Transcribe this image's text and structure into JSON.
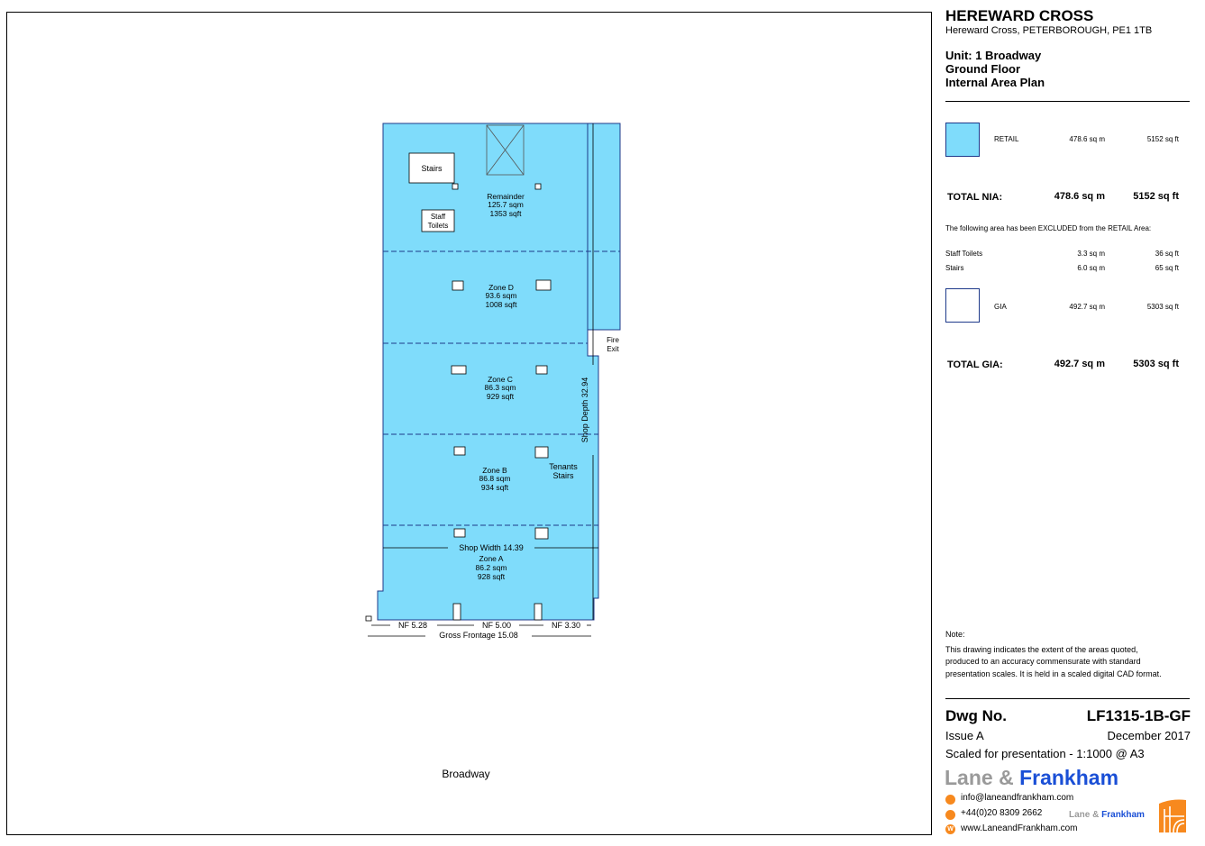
{
  "title": "HEREWARD CROSS",
  "address": "Hereward Cross, PETERBOROUGH, PE1 1TB",
  "unit_lines": [
    "Unit: 1 Broadway",
    "Ground Floor",
    "Internal Area Plan"
  ],
  "legend": {
    "retail": {
      "label": "RETAIL",
      "sqm": "478.6 sq m",
      "sqft": "5152 sq ft",
      "color": "#7fdcfb"
    },
    "total_nia": {
      "label": "TOTAL NIA:",
      "sqm": "478.6 sq m",
      "sqft": "5152 sq ft"
    },
    "excluded_note": "The following area has been EXCLUDED from the RETAIL Area:",
    "excluded": [
      {
        "label": "Staff Toilets",
        "sqm": "3.3 sq m",
        "sqft": "36 sq ft"
      },
      {
        "label": "Stairs",
        "sqm": "6.0 sq m",
        "sqft": "65 sq ft"
      }
    ],
    "gia": {
      "label": "GIA",
      "sqm": "492.7 sq m",
      "sqft": "5303 sq ft"
    },
    "total_gia": {
      "label": "TOTAL GIA:",
      "sqm": "492.7 sq m",
      "sqft": "5303 sq ft"
    }
  },
  "note": {
    "heading": "Note:",
    "lines": [
      "This drawing indicates the extent of the areas quoted,",
      "produced to an accuracy commensurate with standard",
      "presentation scales. It is held in a scaled digital CAD format."
    ]
  },
  "drawing": {
    "dwg_label": "Dwg No.",
    "dwg_no": "LF1315-1B-GF",
    "issue": "Issue  A",
    "date": "December 2017",
    "scale": "Scaled for presentation - 1:1000 @ A3"
  },
  "brand": {
    "name_part1": "Lane",
    "ampersand": "&",
    "name_part2": "Frankham",
    "email": "info@laneandfrankham.com",
    "phone": "+44(0)20 8309 2662",
    "web": "www.LaneandFrankham.com",
    "web_icon": "W",
    "small_part1": "Lane",
    "small_amp": "&",
    "small_part2": "Frankham",
    "accent_orange": "#f7891e",
    "accent_blue": "#1a4fd6"
  },
  "plan": {
    "stairs": "Stairs",
    "staff_toilets": [
      "Staff",
      "Toilets"
    ],
    "fire_exit": [
      "Fire",
      "Exit"
    ],
    "tenants_stairs": [
      "Tenants",
      "Stairs"
    ],
    "zones": [
      {
        "name": "Remainder",
        "sqm": "125.7 sqm",
        "sqft": "1353 sqft"
      },
      {
        "name": "Zone D",
        "sqm": "93.6 sqm",
        "sqft": "1008 sqft"
      },
      {
        "name": "Zone C",
        "sqm": "86.3 sqm",
        "sqft": "929 sqft"
      },
      {
        "name": "Zone B",
        "sqm": "86.8 sqm",
        "sqft": "934 sqft"
      },
      {
        "name": "Zone A",
        "sqm": "86.2 sqm",
        "sqft": "928 sqft"
      }
    ],
    "shop_width": "Shop  Width  14.39",
    "shop_depth": "Shop  Depth  32.94",
    "nf": [
      "NF  5.28",
      "NF  5.00",
      "NF  3.30"
    ],
    "gross_frontage": "Gross  Frontage  15.08",
    "street": "Broadway"
  }
}
